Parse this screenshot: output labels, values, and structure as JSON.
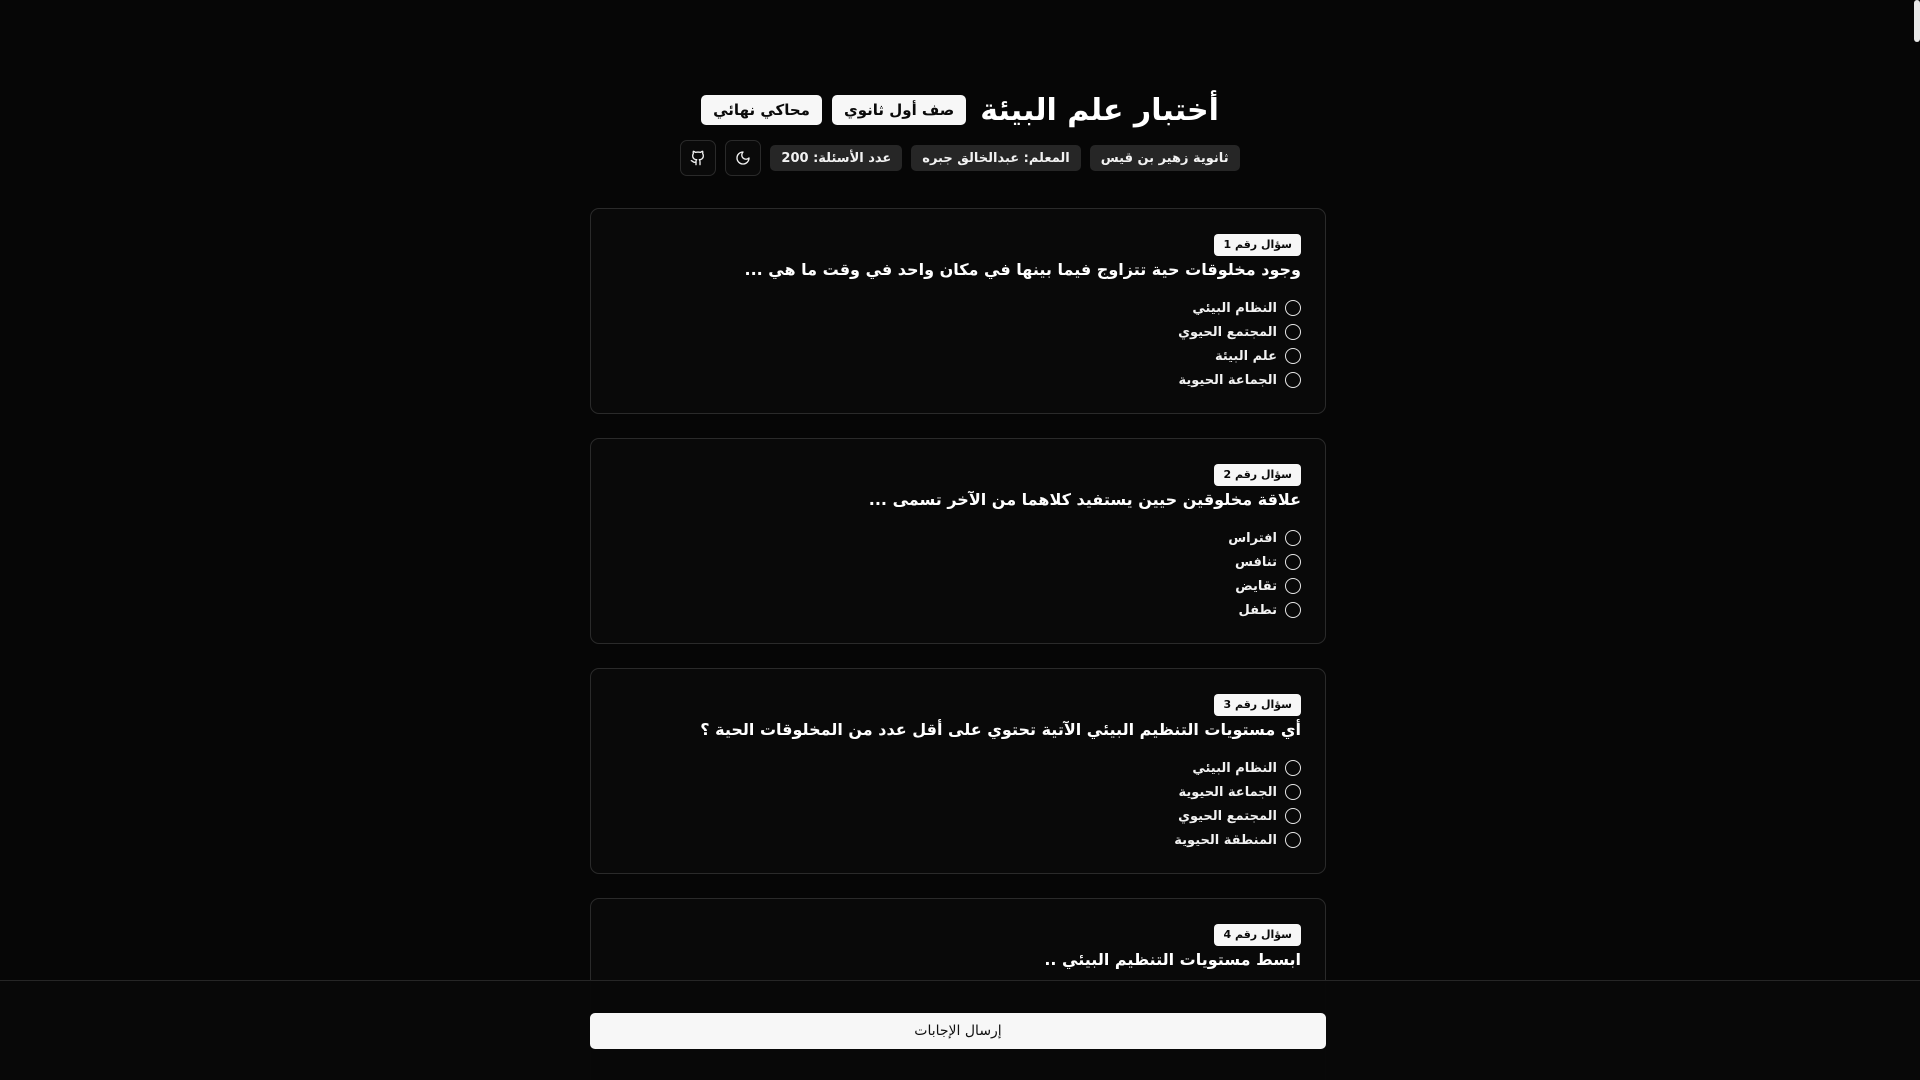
{
  "header": {
    "title": "أختبار علم البيئة",
    "grade_badge": "صف أول ثانوي",
    "mode_badge": "محاكي نهائي",
    "school": "ثانوية زهير بن قيس",
    "teacher": "المعلم: عبدالخالق جبره",
    "question_count": "عدد الأسئلة: 200",
    "theme_toggle_icon": "moon-icon",
    "github_icon": "github-icon"
  },
  "questions": [
    {
      "badge": "سؤال رقم 1",
      "text": "وجود مخلوقات حية تتزاوج فيما بينها في مكان واحد في وقت ما هي ...",
      "options": [
        "النظام البيئي",
        "المجتمع الحيوي",
        "علم البيئة",
        "الجماعة الحيوية"
      ]
    },
    {
      "badge": "سؤال رقم 2",
      "text": "علاقة مخلوقين حيين يستفيد كلاهما من الآخر تسمى ...",
      "options": [
        "افتراس",
        "تنافس",
        "تقايض",
        "تطفل"
      ]
    },
    {
      "badge": "سؤال رقم 3",
      "text": "أي مستويات التنظيم البيئي الآتية تحتوي على أقل عدد من المخلوقات الحية ؟",
      "options": [
        "النظام البيئي",
        "الجماعة الحيوية",
        "المجتمع الحيوي",
        "المنطقة الحيوية"
      ]
    },
    {
      "badge": "سؤال رقم 4",
      "text": "ابسط مستويات التنظيم البيئي ..",
      "options": []
    }
  ],
  "footer": {
    "submit_label": "إرسال الإجابات"
  }
}
